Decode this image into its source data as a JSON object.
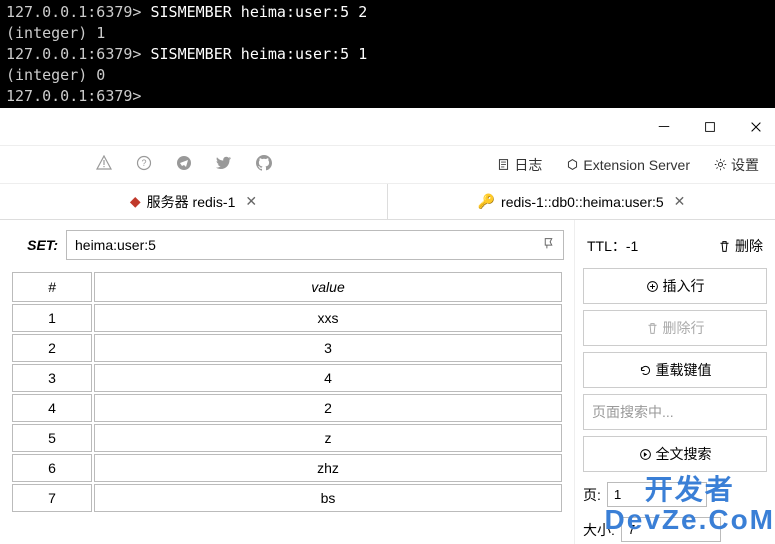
{
  "terminal": {
    "lines": [
      {
        "prompt": "127.0.0.1:6379>",
        "cmd": " SISMEMBER heima:user:5 2"
      },
      {
        "prompt": "(integer) 1",
        "cmd": ""
      },
      {
        "prompt": "127.0.0.1:6379>",
        "cmd": " SISMEMBER heima:user:5 1"
      },
      {
        "prompt": "(integer) 0",
        "cmd": ""
      },
      {
        "prompt": "127.0.0.1:6379>",
        "cmd": ""
      }
    ]
  },
  "toolbar": {
    "log_label": "日志",
    "ext_label": "Extension Server",
    "settings_label": "设置"
  },
  "tabs": [
    {
      "label": "服务器 redis-1"
    },
    {
      "label": "redis-1::db0::heima:user:5"
    }
  ],
  "key": {
    "type_label": "SET:",
    "name": "heima:user:5"
  },
  "table": {
    "headers": [
      "#",
      "value"
    ],
    "rows": [
      [
        "1",
        "xxs"
      ],
      [
        "2",
        "3"
      ],
      [
        "3",
        "4"
      ],
      [
        "4",
        "2"
      ],
      [
        "5",
        "z"
      ],
      [
        "6",
        "zhz"
      ],
      [
        "7",
        "bs"
      ]
    ]
  },
  "side": {
    "ttl_label": "TTL：",
    "ttl_value": "-1",
    "delete_label": "删除",
    "insert_label": "插入行",
    "delete_row_label": "删除行",
    "reload_label": "重载键值",
    "search_placeholder": "页面搜索中...",
    "full_search_label": "全文搜索",
    "page_label": "页:",
    "page_value": "1",
    "size_label": "大小:",
    "size_value": "7"
  },
  "watermark": "开发者\nDevZe.CoM"
}
